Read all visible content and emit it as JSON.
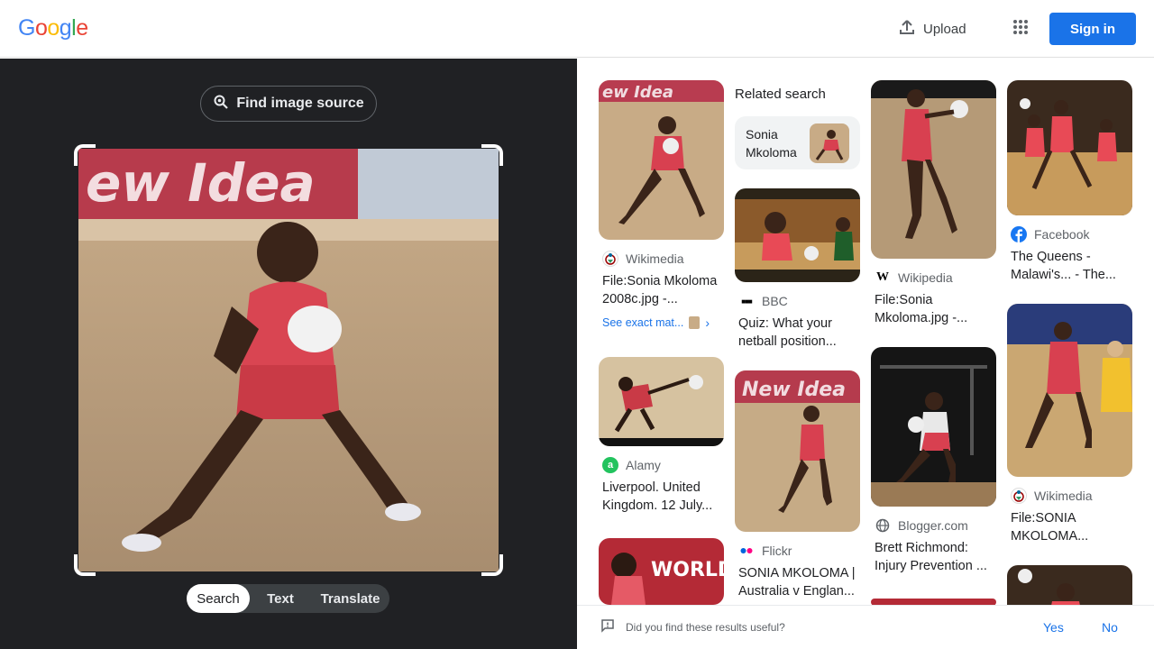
{
  "header": {
    "logo_letters": [
      {
        "ch": "G",
        "color": "#4285F4"
      },
      {
        "ch": "o",
        "color": "#EA4335"
      },
      {
        "ch": "o",
        "color": "#FBBC05"
      },
      {
        "ch": "g",
        "color": "#4285F4"
      },
      {
        "ch": "l",
        "color": "#34A853"
      },
      {
        "ch": "e",
        "color": "#EA4335"
      }
    ],
    "upload_label": "Upload",
    "signin_label": "Sign in",
    "accent_color": "#1a73e8"
  },
  "left_panel": {
    "find_source_label": "Find image source",
    "modes": [
      "Search",
      "Text",
      "Translate"
    ],
    "active_mode": "Search"
  },
  "results": {
    "related_search_title": "Related search",
    "related_chip_label": "Sonia Mkoloma",
    "cards": [
      {
        "source": "Wikimedia",
        "icon": "wikimedia-icon",
        "title": "File:Sonia Mkoloma 2008c.jpg -...",
        "exact_match": "See exact mat..."
      },
      {
        "source": "Alamy",
        "icon": "alamy-icon",
        "title": "Liverpool. United Kingdom. 12 July..."
      },
      {
        "source": "BBC",
        "icon": "bbc-icon",
        "title": "Quiz: What your netball position..."
      },
      {
        "source": "Flickr",
        "icon": "flickr-icon",
        "title": "SONIA MKOLOMA | Australia v Englan..."
      },
      {
        "source": "Wikipedia",
        "icon": "wikipedia-icon",
        "title": "File:Sonia Mkoloma.jpg -..."
      },
      {
        "source": "Blogger.com",
        "icon": "globe-icon",
        "title": "Brett Richmond: Injury Prevention ..."
      },
      {
        "source": "Facebook",
        "icon": "facebook-icon",
        "title": "The Queens - Malawi's... - The..."
      },
      {
        "source": "Wikimedia",
        "icon": "wikimedia-icon",
        "title": "File:SONIA MKOLOMA..."
      }
    ]
  },
  "feedback": {
    "question": "Did you find these results useful?",
    "yes_label": "Yes",
    "no_label": "No"
  }
}
